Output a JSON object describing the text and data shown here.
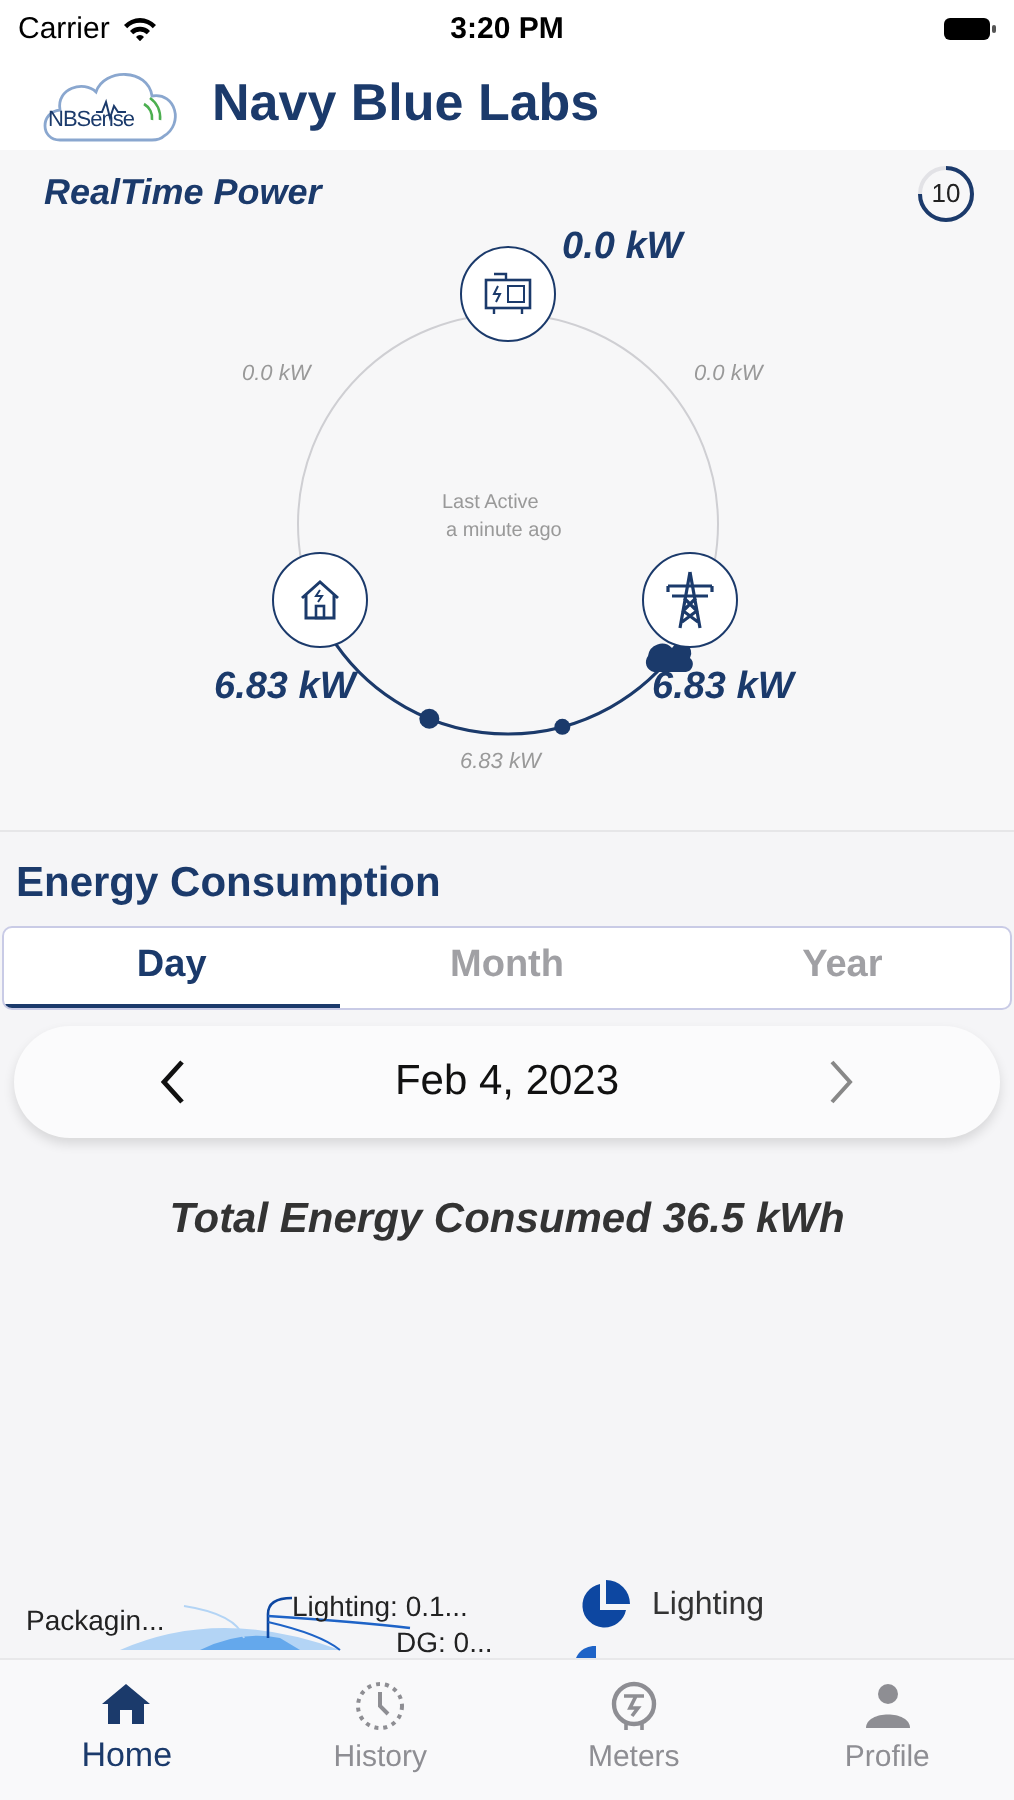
{
  "status_bar": {
    "carrier": "Carrier",
    "time": "3:20 PM"
  },
  "header": {
    "logo": "NBSense",
    "title": "Navy Blue Labs"
  },
  "realtime": {
    "title": "RealTime Power",
    "refresh_count": "10",
    "last_active": "Last Active",
    "last_active_time": "a minute ago",
    "nodes": [
      {
        "kind": "generator",
        "reading": "0.0 kW"
      },
      {
        "kind": "home",
        "reading": "6.83 kW"
      },
      {
        "kind": "grid",
        "reading": "6.83 kW"
      }
    ],
    "flows": [
      {
        "reading": "0.0 kW",
        "active": false
      },
      {
        "reading": "0.0 kW",
        "active": false
      },
      {
        "reading": "6.83 kW",
        "active": true
      }
    ]
  },
  "energy": {
    "title": "Energy Consumption",
    "tabs": [
      {
        "label": "Day",
        "selected": true
      },
      {
        "label": "Month",
        "selected": false
      },
      {
        "label": "Year",
        "selected": false
      }
    ],
    "date": "Feb 4, 2023",
    "total": "Total Energy Consumed 36.5 kWh",
    "chart_labels": [
      "Packagin...",
      "Lighting: 0.1...",
      "DG: 0..."
    ],
    "legend": [
      {
        "label": "Lighting",
        "color": "#0d47a1"
      }
    ]
  },
  "tab_bar": [
    {
      "kind": "home",
      "label": "Home",
      "selected": true
    },
    {
      "kind": "history",
      "label": "History",
      "selected": false
    },
    {
      "kind": "meters",
      "label": "Meters",
      "selected": false
    },
    {
      "kind": "profile",
      "label": "Profile",
      "selected": false
    }
  ]
}
